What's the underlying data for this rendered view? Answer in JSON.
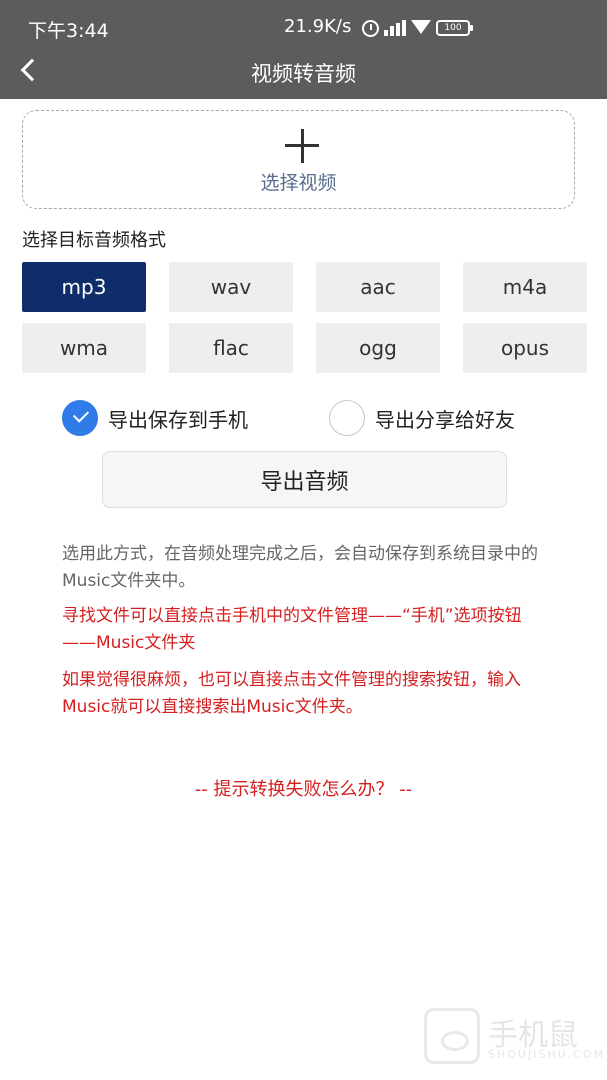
{
  "status_bar": {
    "time": "下午3:44",
    "network_speed": "21.9K/s",
    "battery": "100",
    "icons": [
      "alarm-icon",
      "signal-icon",
      "wifi-icon",
      "battery-icon"
    ]
  },
  "header": {
    "title": "视频转音频",
    "back_icon": "chevron-left-icon"
  },
  "picker": {
    "icon": "plus-icon",
    "label": "选择视频"
  },
  "format_section": {
    "title": "选择目标音频格式",
    "selected": "mp3",
    "formats": [
      "mp3",
      "wav",
      "aac",
      "m4a",
      "wma",
      "flac",
      "ogg",
      "opus"
    ]
  },
  "export_options": {
    "save": {
      "label": "导出保存到手机",
      "checked": true
    },
    "share": {
      "label": "导出分享给好友",
      "checked": false
    }
  },
  "export_button": {
    "label": "导出音频"
  },
  "notes": {
    "info": "选用此方式，在音频处理完成之后，会自动保存到系统目录中的Music文件夹中。",
    "tip1": "寻找文件可以直接点击手机中的文件管理——“手机”选项按钮——Music文件夹",
    "tip2": "如果觉得很麻烦，也可以直接点击文件管理的搜索按钮，输入Music就可以直接搜索出Music文件夹。",
    "fail_link": "-- 提示转换失败怎么办？ --"
  },
  "watermark": {
    "cn": "手机鼠",
    "en": "SHOUJISHU.COM"
  },
  "colors": {
    "header_bg": "#5c5c5c",
    "selected_format": "#0f2d6b",
    "radio_on": "#2f7be8",
    "warning_text": "#d42020",
    "picker_label": "#5a6d8e"
  }
}
